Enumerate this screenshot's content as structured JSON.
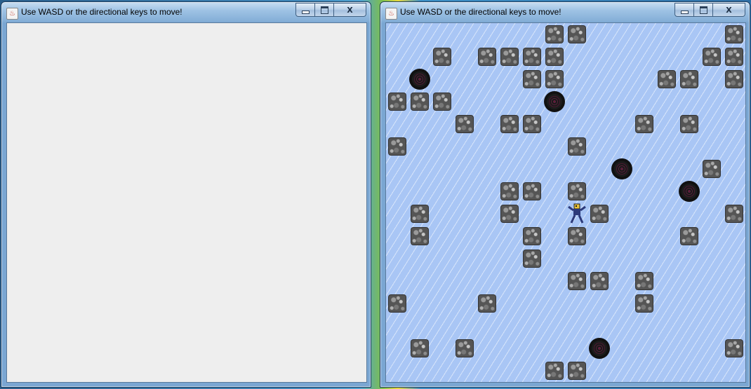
{
  "windows": {
    "left": {
      "title": "Use WASD or the directional keys to move!",
      "controls": {
        "minimize": "minimize",
        "maximize": "maximize",
        "close": "X"
      }
    },
    "right": {
      "title": "Use WASD or the directional keys to move!",
      "controls": {
        "minimize": "minimize",
        "maximize": "maximize",
        "close": "X"
      }
    }
  },
  "game": {
    "grid_cols": 16,
    "grid_rows": 16,
    "tile": "ice",
    "colors": {
      "ice": "#a9c6f5",
      "rock": "#555555",
      "hole": "#1a1a1a",
      "player": "#2c3a7a"
    },
    "rocks": [
      [
        7,
        0
      ],
      [
        8,
        0
      ],
      [
        15,
        0
      ],
      [
        2,
        1
      ],
      [
        4,
        1
      ],
      [
        5,
        1
      ],
      [
        6,
        1
      ],
      [
        7,
        1
      ],
      [
        14,
        1
      ],
      [
        15,
        1
      ],
      [
        6,
        2
      ],
      [
        7,
        2
      ],
      [
        12,
        2
      ],
      [
        13,
        2
      ],
      [
        15,
        2
      ],
      [
        0,
        3
      ],
      [
        1,
        3
      ],
      [
        2,
        3
      ],
      [
        3,
        4
      ],
      [
        5,
        4
      ],
      [
        6,
        4
      ],
      [
        11,
        4
      ],
      [
        13,
        4
      ],
      [
        0,
        5
      ],
      [
        8,
        5
      ],
      [
        14,
        6
      ],
      [
        5,
        7
      ],
      [
        6,
        7
      ],
      [
        8,
        7
      ],
      [
        1,
        8
      ],
      [
        5,
        8
      ],
      [
        9,
        8
      ],
      [
        15,
        8
      ],
      [
        1,
        9
      ],
      [
        6,
        9
      ],
      [
        8,
        9
      ],
      [
        13,
        9
      ],
      [
        6,
        10
      ],
      [
        8,
        11
      ],
      [
        9,
        11
      ],
      [
        11,
        11
      ],
      [
        0,
        12
      ],
      [
        4,
        12
      ],
      [
        11,
        12
      ],
      [
        1,
        14
      ],
      [
        3,
        14
      ],
      [
        15,
        14
      ],
      [
        7,
        15
      ],
      [
        8,
        15
      ]
    ],
    "holes": [
      [
        1,
        2
      ],
      [
        7,
        3
      ],
      [
        10,
        6
      ],
      [
        13,
        7
      ],
      [
        9,
        14
      ]
    ],
    "player": [
      8,
      8
    ]
  }
}
